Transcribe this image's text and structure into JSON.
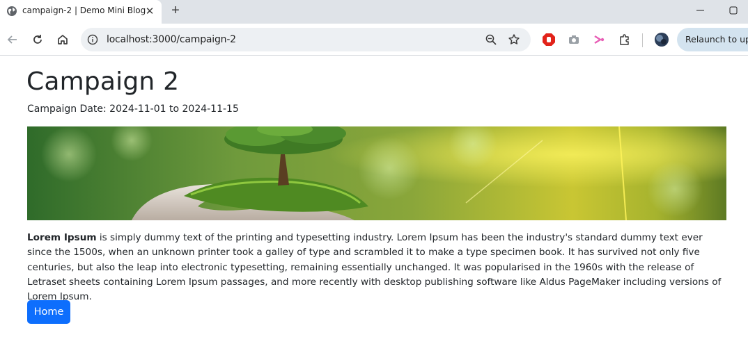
{
  "browser": {
    "tab": {
      "title": "campaign-2 | Demo Mini Blog",
      "close_glyph": "✕"
    },
    "new_tab_glyph": "+",
    "address": {
      "url": "localhost:3000/campaign-2"
    },
    "relaunch_label": "Relaunch to upda"
  },
  "page": {
    "title": "Campaign 2",
    "campaign_date": "Campaign Date: 2024-11-01 to 2024-11-15",
    "banner_alt": "",
    "body_lead": "Lorem Ipsum",
    "body_text": " is simply dummy text of the printing and typesetting industry. Lorem Ipsum has been the industry's standard dummy text ever since the 1500s, when an unknown printer took a galley of type and scrambled it to make a type specimen book. It has survived not only five centuries, but also the leap into electronic typesetting, remaining essentially unchanged. It was popularised in the 1960s with the release of Letraset sheets containing Lorem Ipsum passages, and more recently with desktop publishing software like Aldus PageMaker including versions of Lorem Ipsum.",
    "home_button": "Home"
  },
  "colors": {
    "primary_button": "#0d6efd",
    "text": "#212529",
    "tabstrip": "#dfe3e8",
    "omnibox": "#edf0f3",
    "relaunch": "#d3e3ef"
  },
  "icons": [
    "globe-icon",
    "close-icon",
    "plus-icon",
    "minimize-icon",
    "maximize-icon",
    "back-icon",
    "reload-icon",
    "home-icon",
    "info-icon",
    "zoom-icon",
    "star-icon",
    "adblock-icon",
    "camera-icon",
    "share-icon",
    "extensions-icon",
    "avatar"
  ]
}
